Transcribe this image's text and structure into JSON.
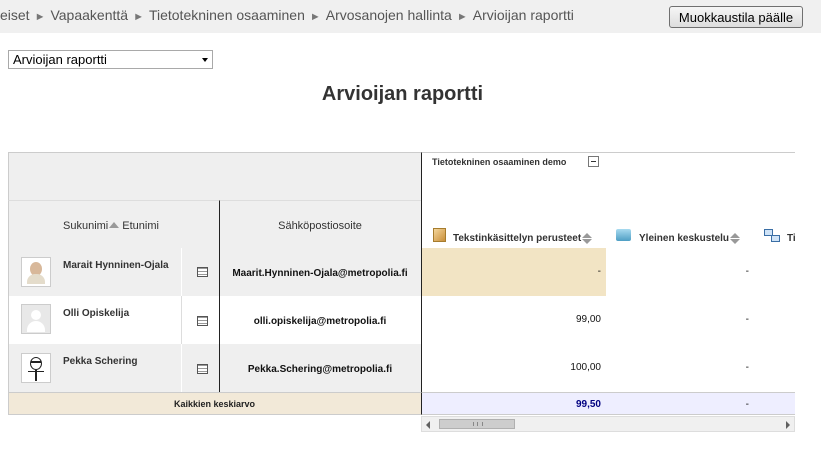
{
  "breadcrumb": {
    "items": [
      "eiset",
      "Vapaakenttä",
      "Tietotekninen osaaminen",
      "Arvosanojen hallinta",
      "Arvioijan raportti"
    ],
    "separator": "►"
  },
  "toolbar": {
    "edit_button_label": "Muokkaustila päälle"
  },
  "report_select": {
    "selected": "Arvioijan raportti"
  },
  "page_title": "Arvioijan raportti",
  "grader": {
    "category_name": "Tietotekninen osaaminen demo",
    "headers": {
      "surname": "Sukunimi",
      "firstname": "Etunimi",
      "email": "Sähköpostiosoite",
      "items": [
        "Tekstinkäsittelyn perusteet",
        "Yleinen keskustelu",
        "Ti"
      ]
    },
    "rows": [
      {
        "name": "Marait Hynninen-Ojala",
        "email": "Maarit.Hynninen-Ojala@metropolia.fi",
        "grades": [
          "-",
          "-"
        ],
        "avatar": "photo"
      },
      {
        "name": "Olli Opiskelija",
        "email": "olli.opiskelija@metropolia.fi",
        "grades": [
          "99,00",
          "-"
        ],
        "avatar": "default-user"
      },
      {
        "name": "Pekka Schering",
        "email": "Pekka.Schering@metropolia.fi",
        "grades": [
          "100,00",
          "-"
        ],
        "avatar": "drawing"
      }
    ],
    "average": {
      "label": "Kaikkien keskiarvo",
      "values": [
        "99,50",
        "-"
      ]
    }
  },
  "colors": {
    "header_bg": "#efefef",
    "highlight": "#f2e4c4",
    "average_row": "#f2e9d8",
    "average_grades": "#eeeeff",
    "average_value": "#000080"
  }
}
